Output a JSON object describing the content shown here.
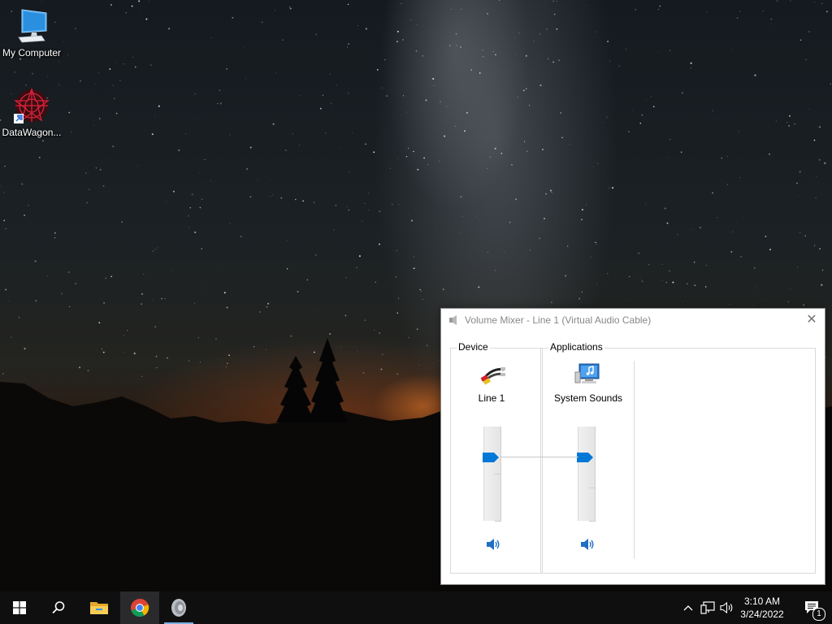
{
  "desktop": {
    "icons": [
      {
        "label": "My Computer",
        "icon": "monitor-icon"
      },
      {
        "label": "DataWagon...",
        "icon": "datawagon-icon"
      }
    ]
  },
  "mixer": {
    "title": "Volume Mixer - Line 1 (Virtual Audio Cable)",
    "close_glyph": "✕",
    "device_section": "Device",
    "applications_section": "Applications",
    "channels": [
      {
        "name": "Line 1",
        "icon": "audio-cable-icon",
        "volume_percent": 70
      },
      {
        "name": "System Sounds",
        "icon": "system-sounds-icon",
        "volume_percent": 70
      }
    ]
  },
  "taskbar": {
    "time": "3:10 AM",
    "date": "3/24/2022",
    "notification_count": "1",
    "pinned": [
      "start-icon",
      "search-icon",
      "file-explorer-icon",
      "chrome-icon",
      "speaker-app-icon"
    ],
    "accent": "#0078d7"
  }
}
